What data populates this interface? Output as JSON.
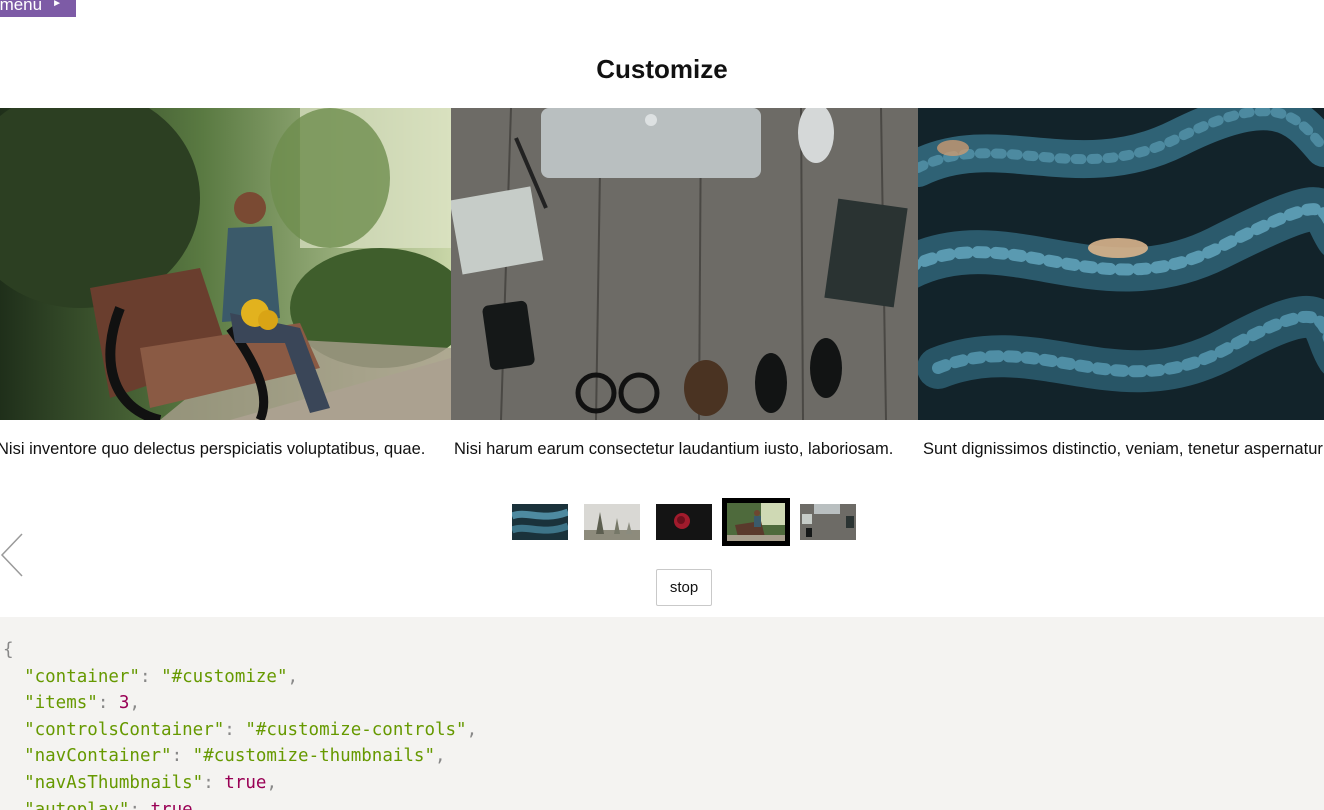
{
  "header": {
    "menu_label": "menu",
    "menu_arrow": "►"
  },
  "page_title": "Customize",
  "slides": [
    {
      "name": "woman-bench-photo"
    },
    {
      "name": "desk-laptop-photo"
    },
    {
      "name": "rope-closeup-photo"
    }
  ],
  "captions": [
    "Nisi inventore quo delectus perspiciatis voluptatibus, quae.",
    "Nisi harum earum consectetur laudantium iusto, laboriosam.",
    "Sunt dignissimos distinctio, veniam, tenetur aspernatur"
  ],
  "thumbnails": [
    {
      "name": "rope-thumbnail",
      "active": false
    },
    {
      "name": "foggy-forest-thumbnail",
      "active": false
    },
    {
      "name": "red-rose-thumbnail",
      "active": false
    },
    {
      "name": "woman-bench-thumbnail",
      "active": true
    },
    {
      "name": "desk-thumbnail",
      "active": false
    }
  ],
  "controls": {
    "stop_label": "stop",
    "prev_icon": "chevron-left-icon"
  },
  "code": {
    "open": "{",
    "lines": [
      {
        "key": "\"container\"",
        "value": "\"#customize\"",
        "type": "string"
      },
      {
        "key": "\"items\"",
        "value": "3",
        "type": "number"
      },
      {
        "key": "\"controlsContainer\"",
        "value": "\"#customize-controls\"",
        "type": "string"
      },
      {
        "key": "\"navContainer\"",
        "value": "\"#customize-thumbnails\"",
        "type": "string"
      },
      {
        "key": "\"navAsThumbnails\"",
        "value": "true",
        "type": "boolean"
      },
      {
        "key": "\"autoplay\"",
        "value": "true",
        "type": "boolean"
      }
    ]
  },
  "colors": {
    "menu_bg": "#7d5ba6",
    "code_bg": "#f4f3f1",
    "code_string": "#669900",
    "code_number": "#990055",
    "code_punct": "#888888"
  }
}
